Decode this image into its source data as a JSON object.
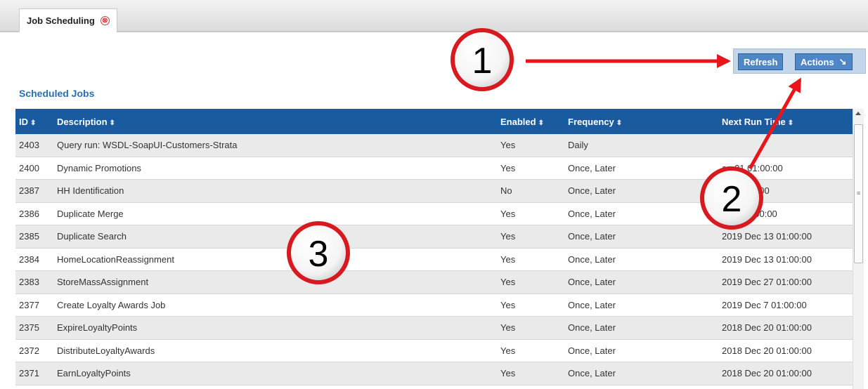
{
  "tab": {
    "label": "Job Scheduling",
    "close_glyph": "⊗"
  },
  "toolbar": {
    "refresh_label": "Refresh",
    "actions_label": "Actions",
    "actions_icon_glyph": "↘"
  },
  "section_title": "Scheduled Jobs",
  "table": {
    "columns": [
      "ID",
      "Description",
      "Enabled",
      "Frequency",
      "Next Run Time"
    ],
    "rows": [
      [
        "2403",
        "Query run: WSDL-SoapUI-Customers-Strata",
        "Yes",
        "Daily",
        ""
      ],
      [
        "2400",
        "Dynamic Promotions",
        "Yes",
        "Once, Later",
        "an 31 01:00:00"
      ],
      [
        "2387",
        "HH Identification",
        "No",
        "Once, Later",
        "11 01:00:00"
      ],
      [
        "2386",
        "Duplicate Merge",
        "Yes",
        "Once, Later",
        "c 13 01:00:00"
      ],
      [
        "2385",
        "Duplicate Search",
        "Yes",
        "Once, Later",
        "2019 Dec 13 01:00:00"
      ],
      [
        "2384",
        "HomeLocationReassignment",
        "Yes",
        "Once, Later",
        "2019 Dec 13 01:00:00"
      ],
      [
        "2383",
        "StoreMassAssignment",
        "Yes",
        "Once, Later",
        "2019 Dec 27 01:00:00"
      ],
      [
        "2377",
        "Create Loyalty Awards Job",
        "Yes",
        "Once, Later",
        "2019 Dec 7 01:00:00"
      ],
      [
        "2375",
        "ExpireLoyaltyPoints",
        "Yes",
        "Once, Later",
        "2018 Dec 20 01:00:00"
      ],
      [
        "2372",
        "DistributeLoyaltyAwards",
        "Yes",
        "Once, Later",
        "2018 Dec 20 01:00:00"
      ],
      [
        "2371",
        "EarnLoyaltyPoints",
        "Yes",
        "Once, Later",
        "2018 Dec 20 01:00:00"
      ]
    ]
  },
  "annotations": {
    "callout_1": "1",
    "callout_2": "2",
    "callout_3": "3",
    "arrow_color": "#e8161b"
  },
  "colors": {
    "header_bg": "#1a5a9f",
    "button_bg": "#4f86c6",
    "title_color": "#2a6db5"
  }
}
